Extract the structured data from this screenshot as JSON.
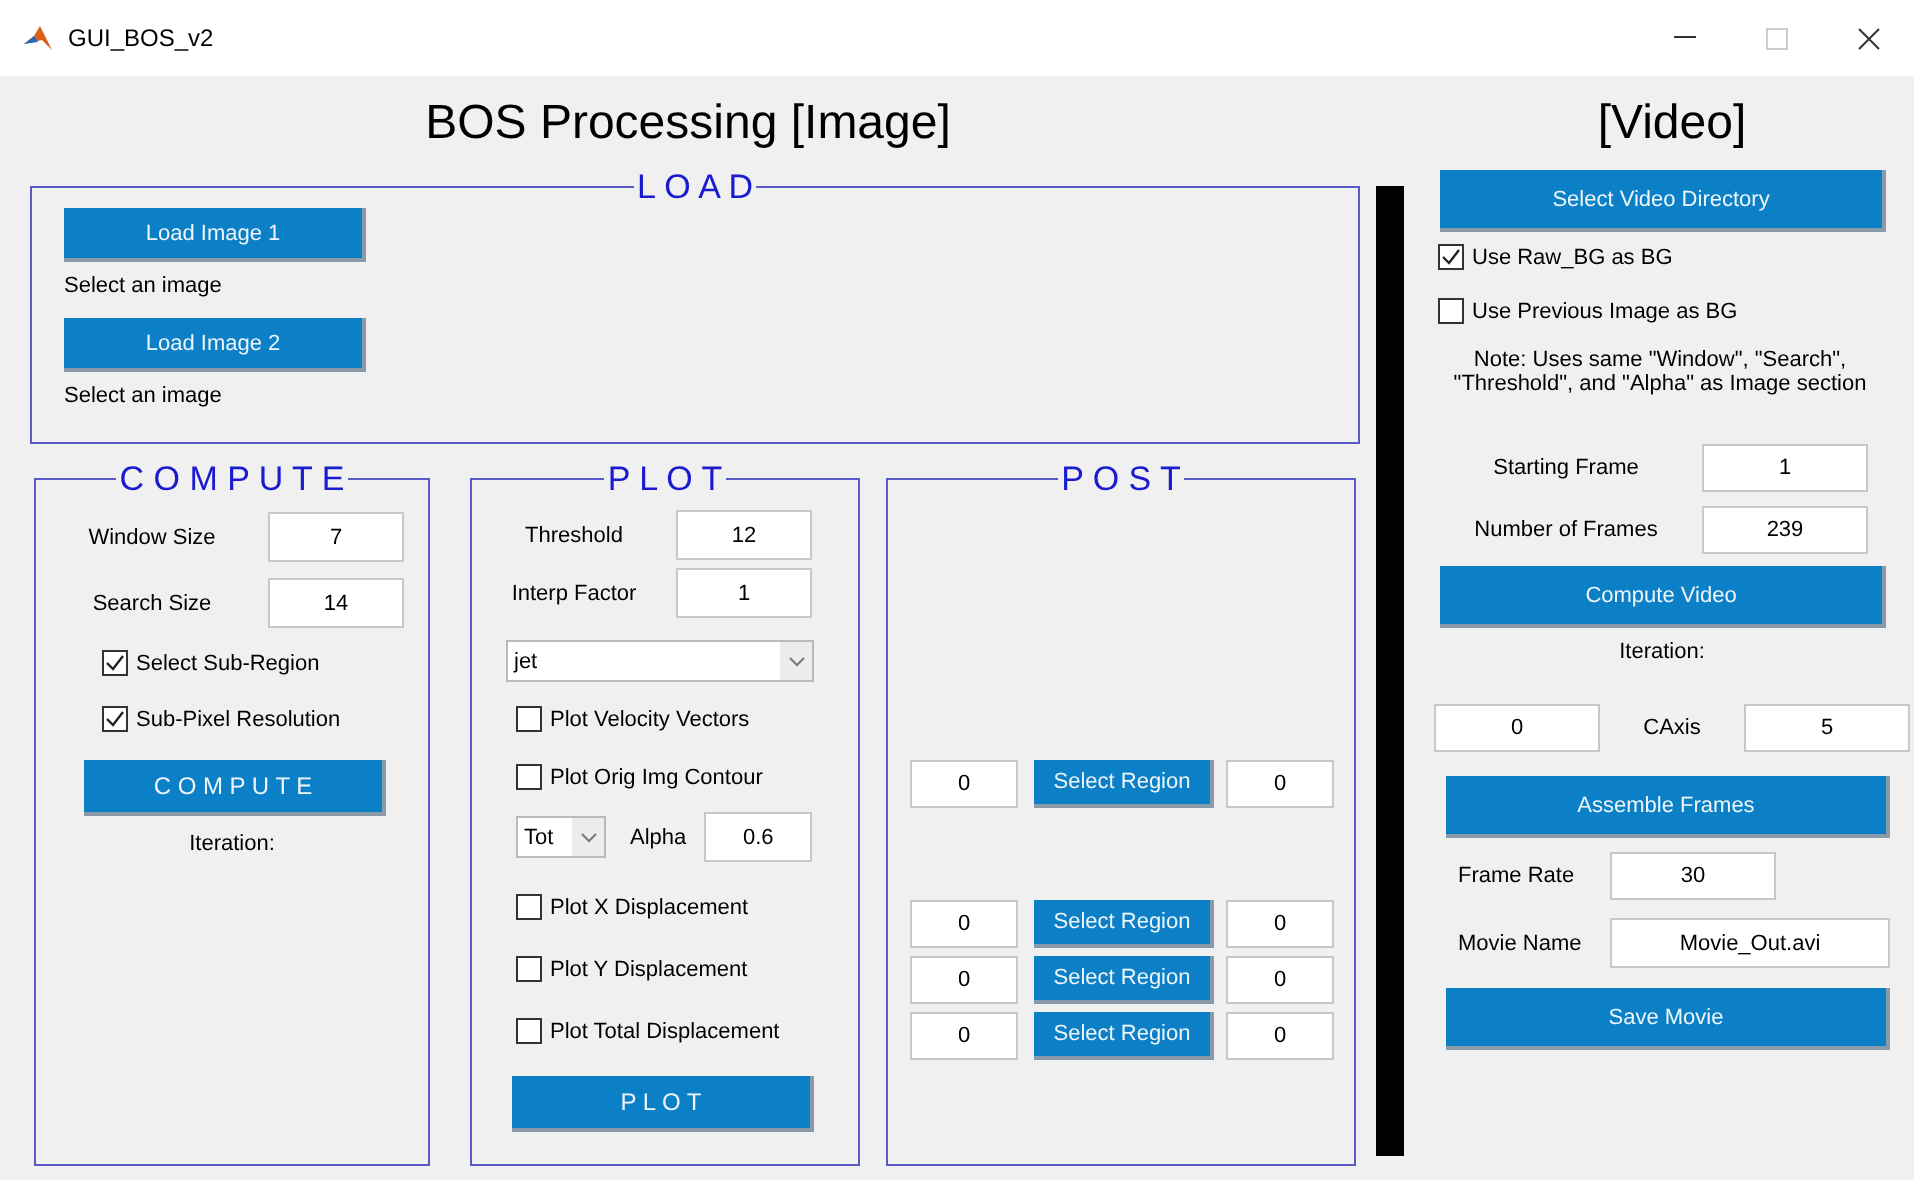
{
  "window": {
    "title": "GUI_BOS_v2"
  },
  "image_heading": "BOS Processing [Image]",
  "load": {
    "legend": "L O A D",
    "items": [
      {
        "button": "Load Image 1",
        "status": "Select an image"
      },
      {
        "button": "Load Image 2",
        "status": "Select an image"
      }
    ]
  },
  "compute": {
    "legend": "C O M P U T E",
    "fields": [
      {
        "label": "Window Size",
        "value": "7"
      },
      {
        "label": "Search Size",
        "value": "14"
      }
    ],
    "checks": [
      {
        "label": "Select Sub-Region",
        "checked": true
      },
      {
        "label": "Sub-Pixel Resolution",
        "checked": true
      }
    ],
    "button": "C O M P U T E",
    "iteration": "Iteration:"
  },
  "plot": {
    "legend": "P L O T",
    "fields": [
      {
        "label": "Threshold",
        "value": "12"
      },
      {
        "label": "Interp Factor",
        "value": "1"
      }
    ],
    "colormap": "jet",
    "checks_top": [
      {
        "label": "Plot Velocity Vectors",
        "checked": false
      },
      {
        "label": "Plot Orig Img Contour",
        "checked": false
      }
    ],
    "contour": {
      "component": "Tot",
      "label": "Alpha",
      "value": "0.6"
    },
    "checks_bottom": [
      {
        "label": "Plot X Displacement",
        "checked": false
      },
      {
        "label": "Plot Y Displacement",
        "checked": false
      },
      {
        "label": "Plot Total Displacement",
        "checked": false
      }
    ],
    "button": "P L O T"
  },
  "post": {
    "legend": "P O S T",
    "groups": [
      [
        {
          "min": "0",
          "button": "Select Region",
          "max": "0"
        }
      ],
      [
        {
          "min": "0",
          "button": "Select Region",
          "max": "0"
        },
        {
          "min": "0",
          "button": "Select Region",
          "max": "0"
        },
        {
          "min": "0",
          "button": "Select Region",
          "max": "0"
        }
      ]
    ]
  },
  "video": {
    "heading": "[Video]",
    "directory_button": "Select Video Directory",
    "checks": [
      {
        "label": "Use Raw_BG as BG",
        "checked": true
      },
      {
        "label": "Use Previous Image as BG",
        "checked": false
      }
    ],
    "note": "Note: Uses same \"Window\", \"Search\", \"Threshold\", and \"Alpha\" as Image section",
    "fields": [
      {
        "label": "Starting Frame",
        "value": "1"
      },
      {
        "label": "Number of Frames",
        "value": "239"
      }
    ],
    "compute_button": "Compute Video",
    "iteration": "Iteration:",
    "caxis": {
      "min": "0",
      "label": "CAxis",
      "max": "5"
    },
    "assemble_button": "Assemble Frames",
    "frame_rate": {
      "label": "Frame Rate",
      "value": "30"
    },
    "movie_name": {
      "label": "Movie Name",
      "value": "Movie_Out.avi"
    },
    "save_button": "Save Movie"
  }
}
